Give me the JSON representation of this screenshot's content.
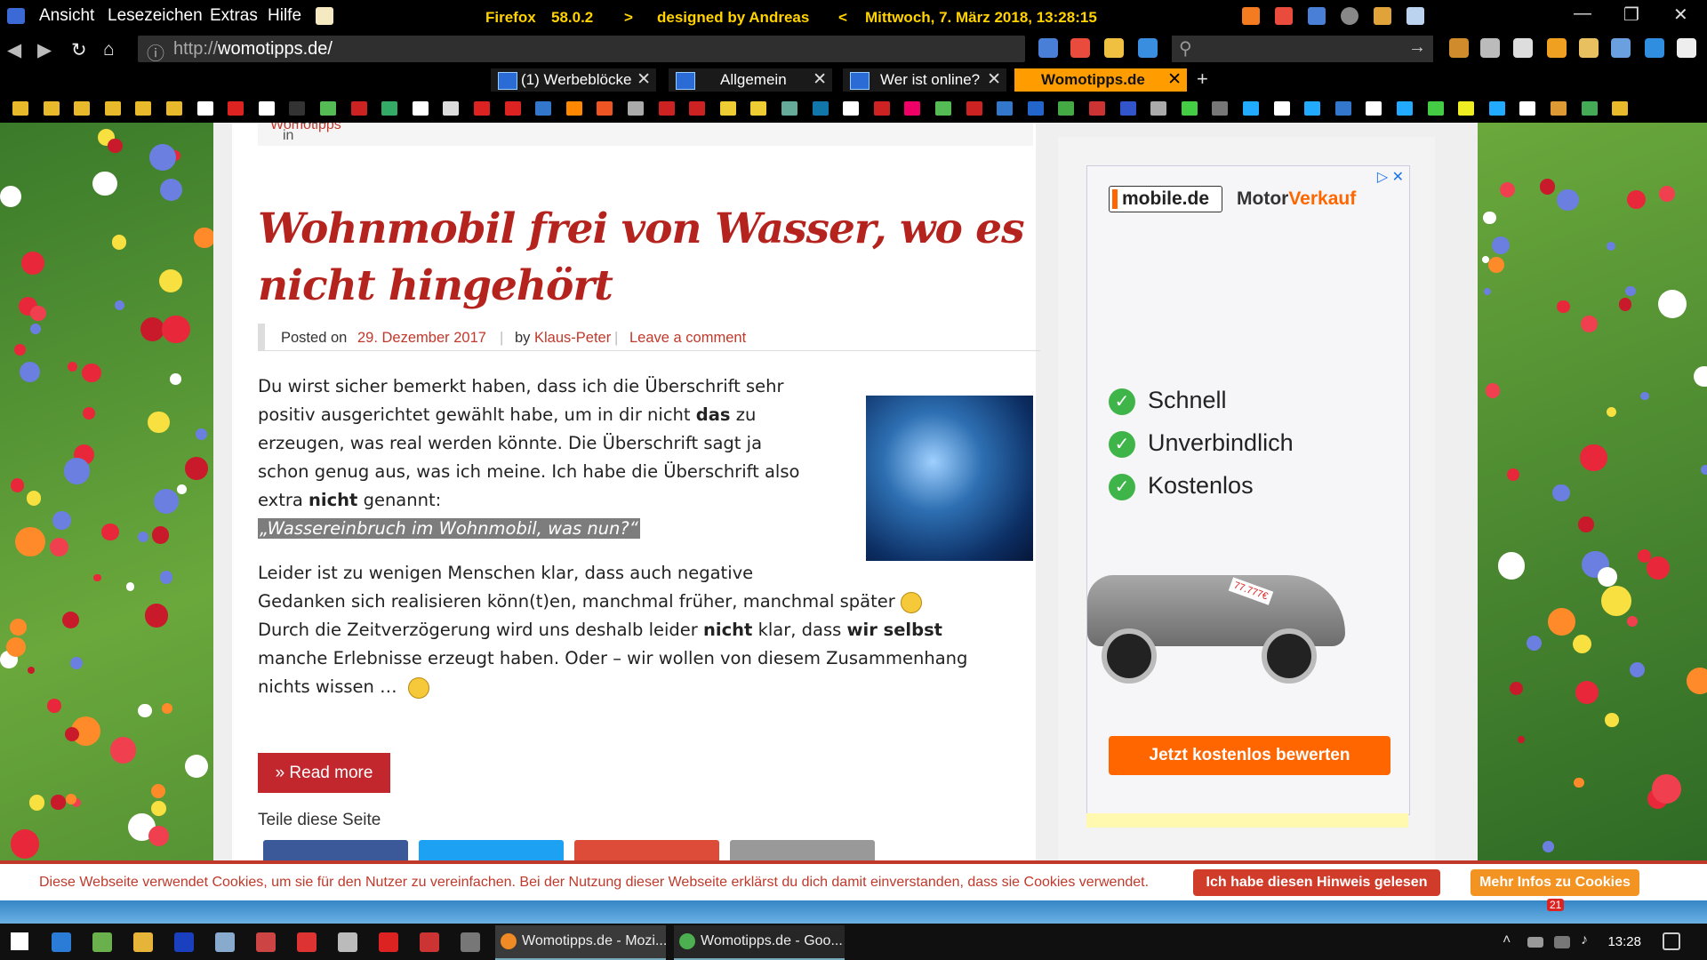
{
  "titlebar": {
    "menu": [
      "Ansicht",
      "Lesezeichen",
      "Extras",
      "Hilfe"
    ],
    "title_segments": [
      "Firefox",
      "58.0.2",
      ">",
      "designed by Andreas",
      "<",
      "Mittwoch, 7. März 2018, 13:28:15"
    ]
  },
  "navbar": {
    "url_prefix": "http://",
    "url_host": "womotipps.de/"
  },
  "tabs": [
    {
      "label": "(1) Werbeblöcke v",
      "active": false
    },
    {
      "label": "Allgemein",
      "active": false
    },
    {
      "label": "Wer ist online?",
      "active": false
    },
    {
      "label": "Womotipps.de",
      "active": true
    }
  ],
  "post": {
    "posted_in_label": "Posted in",
    "posted_in_category": "Womotipps",
    "title": "Wohnmobil frei von Wasser, wo es nicht hingehört",
    "meta": {
      "posted_on_label": "Posted on",
      "date": "29. Dezember 2017",
      "by_label": "by",
      "author": "Klaus-Peter",
      "comment_link": "Leave a comment"
    },
    "p1_lines": [
      "Du wirst sicher bemerkt haben, dass ich die Überschrift sehr",
      "positiv ausgerichtet gewählt habe, um in dir nicht",
      "erzeugen, was real werden könnte. Die Überschrift sagt ja",
      "schon genug aus, was ich meine. Ich habe die Überschrift also",
      "extra"
    ],
    "p1_bold_das": "das",
    "p1_suffix_zu": "zu",
    "p1_bold_nicht": "nicht",
    "p1_suffix_genannt": "genannt:",
    "highlight": "„Wassereinbruch im Wohnmobil, was nun?“",
    "p2_line1": "Leider ist zu wenigen Menschen klar, dass auch negative",
    "p2_line2": "Gedanken sich realisieren könn(t)en, manchmal früher, manchmal später",
    "p3_line1_a": "Durch die Zeitverzögerung wird uns deshalb leider",
    "p3_bold_nicht": "nicht",
    "p3_line1_b": "klar, dass",
    "p3_bold_wir": "wir selbst",
    "p3_line2": "manche Erlebnisse erzeugt haben. Oder – wir wollen von diesem Zusammenhang",
    "p3_line3": "nichts wissen …",
    "read_more": "» Read more",
    "share_label": "Teile diese Seite"
  },
  "ad": {
    "logo_text": "mobile.de",
    "brand_a": "Motor",
    "brand_b": "Verkauf",
    "items": [
      "Schnell",
      "Unverbindlich",
      "Kostenlos"
    ],
    "price_tag": "77.777€",
    "cta": "Jetzt kostenlos bewerten"
  },
  "cookie": {
    "text": "Diese Webseite verwendet Cookies, um sie für den Nutzer zu vereinfachen. Bei der Nutzung dieser Webseite erklärst du dich damit einverstanden, dass sie Cookies verwendet.",
    "accept": "Ich habe diesen Hinweis gelesen",
    "more": "Mehr Infos zu Cookies"
  },
  "taskbar": {
    "tasks": [
      "Womotipps.de - Mozi...",
      "Womotipps.de - Goo..."
    ],
    "badge": "21",
    "clock": "13:28"
  },
  "colors": {
    "accent_red": "#c0392b",
    "tab_active": "#ff9d00",
    "title_yellow": "#ffd200",
    "ad_orange": "#ff6600"
  }
}
